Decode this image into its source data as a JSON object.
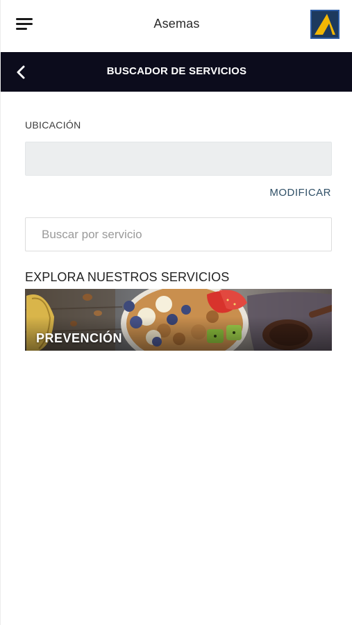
{
  "appbar": {
    "title": "Asemas",
    "menu_icon": "menu-icon",
    "logo_icon": "asemas-logo"
  },
  "subheader": {
    "title": "BUSCADOR DE SERVICIOS",
    "back_icon": "chevron-left-icon"
  },
  "location": {
    "label": "UBICACIÓN",
    "value": "",
    "modify_label": "MODIFICAR"
  },
  "search": {
    "placeholder": "Buscar por servicio",
    "value": ""
  },
  "services": {
    "heading": "EXPLORA NUESTROS SERVICIOS",
    "items": [
      {
        "label": "PREVENCIÓN",
        "image": "healthy-food-bowl"
      }
    ]
  },
  "colors": {
    "subheader_bg": "#0c0c1c",
    "link": "#2f4f66",
    "logo_bg": "#1d3a5e",
    "logo_accent": "#f2b705"
  }
}
